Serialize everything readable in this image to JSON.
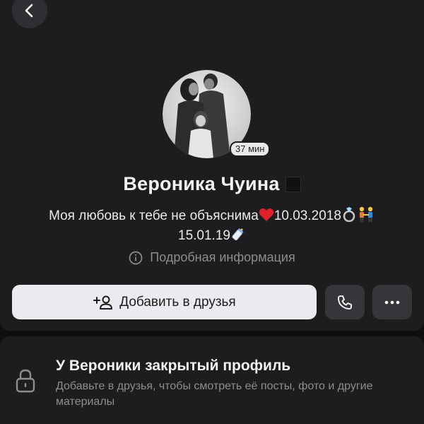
{
  "header": {
    "back_icon": "chevron-left-icon"
  },
  "profile": {
    "name": "Вероника Чуина",
    "last_seen": "37 мин",
    "status_line1": "Моя любовь к тебе не объяснима",
    "status_date1": "10.03.2018",
    "status_line2": "15.01.19",
    "details_label": "Подробная информация",
    "emojis": [
      "red-heart",
      "ring",
      "couple-holding-hands",
      "baby-bottle"
    ]
  },
  "actions": {
    "add_friend_label": "Добавить в друзья",
    "add_friend_icon": "add-user-icon",
    "call_icon": "phone-icon",
    "more_icon": "more-horizontal-icon"
  },
  "private_profile": {
    "title": "У Вероники закрытый профиль",
    "subtitle": "Добавьте в друзья, чтобы смотреть её посты, фото и другие материалы",
    "icon": "lock-icon"
  },
  "colors": {
    "background": "#0f0f10",
    "card": "#1d1d1f",
    "primary_button": "#ebebef",
    "secondary_button": "#35353a",
    "muted_text": "#8d8d92"
  }
}
